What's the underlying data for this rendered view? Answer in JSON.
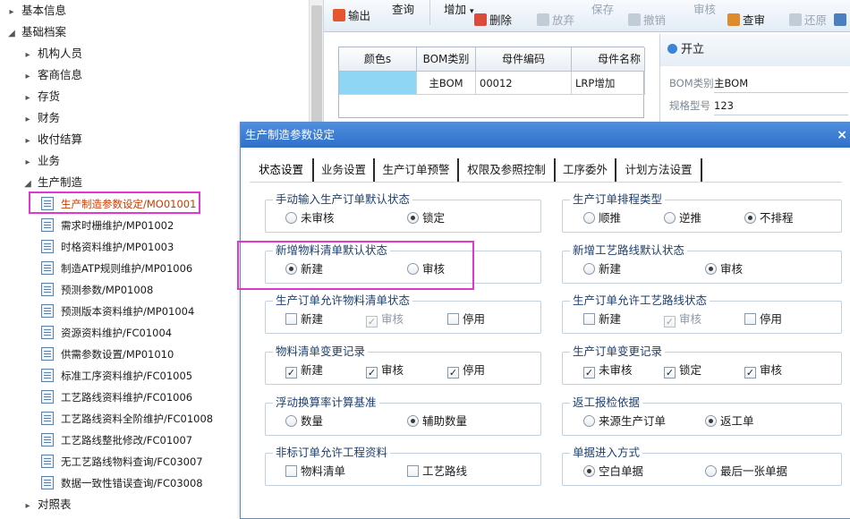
{
  "tree": {
    "items": [
      {
        "label": "基本信息",
        "arrow": "▸",
        "level": 0
      },
      {
        "label": "基础档案",
        "arrow": "◢",
        "level": 0
      },
      {
        "label": "机构人员",
        "arrow": "▸",
        "level": 1
      },
      {
        "label": "客商信息",
        "arrow": "▸",
        "level": 1
      },
      {
        "label": "存货",
        "arrow": "▸",
        "level": 1
      },
      {
        "label": "财务",
        "arrow": "▸",
        "level": 1
      },
      {
        "label": "收付结算",
        "arrow": "▸",
        "level": 1
      },
      {
        "label": "业务",
        "arrow": "▸",
        "level": 1
      },
      {
        "label": "生产制造",
        "arrow": "◢",
        "level": 1
      }
    ],
    "leaves": [
      {
        "label": "生产制造参数设定/MO01001"
      },
      {
        "label": "需求时栅维护/MP01002"
      },
      {
        "label": "时格资料维护/MP01003"
      },
      {
        "label": "制造ATP规则维护/MP01006"
      },
      {
        "label": "预测参数/MP01008"
      },
      {
        "label": "预测版本资料维护/MP01004"
      },
      {
        "label": "资源资料维护/FC01004"
      },
      {
        "label": "供需参数设置/MP01010"
      },
      {
        "label": "标准工序资料维护/FC01005"
      },
      {
        "label": "工艺路线资料维护/FC01006"
      },
      {
        "label": "工艺路线资料全阶维护/FC01008"
      },
      {
        "label": "工艺路线整批修改/FC01007"
      },
      {
        "label": "无工艺路线物料查询/FC03007"
      },
      {
        "label": "数据一致性错误查询/FC03008"
      }
    ],
    "last": {
      "label": "对照表",
      "arrow": "▸"
    }
  },
  "toolbar": {
    "output": "输出",
    "query": "查询",
    "add": "增加",
    "delete": "删除",
    "abandon": "放弃",
    "save": "保存",
    "revoke": "撤销",
    "audit": "审核",
    "check": "查审",
    "restore": "还原"
  },
  "grid": {
    "columns": [
      "颜色s",
      "BOM类别",
      "母件编码",
      "母件名称"
    ],
    "row": [
      "",
      "主BOM",
      "00012",
      "LRP增加"
    ]
  },
  "props": {
    "header": "开立",
    "bom_label": "BOM类别",
    "bom_value": "主BOM",
    "spec_label": "规格型号",
    "spec_value": "123"
  },
  "dialog": {
    "title": "生产制造参数设定",
    "close": "×",
    "tabs": [
      "状态设置",
      "业务设置",
      "生产订单预警",
      "权限及参照控制",
      "工序委外",
      "计划方法设置"
    ],
    "groups": {
      "g1": {
        "title": "手动输入生产订单默认状态",
        "opts": [
          "未审核",
          "锁定"
        ]
      },
      "g2": {
        "title": "新增物料清单默认状态",
        "opts": [
          "新建",
          "审核"
        ]
      },
      "g3": {
        "title": "生产订单允许物料清单状态",
        "opts": [
          "新建",
          "审核",
          "停用"
        ]
      },
      "g4": {
        "title": "物料清单变更记录",
        "opts": [
          "新建",
          "审核",
          "停用"
        ]
      },
      "g5": {
        "title": "浮动换算率计算基准",
        "opts": [
          "数量",
          "辅助数量"
        ]
      },
      "g6": {
        "title": "非标订单允许工程资料",
        "opts": [
          "物料清单",
          "工艺路线"
        ]
      },
      "g7": {
        "title": "生产订单排程类型",
        "opts": [
          "顺推",
          "逆推",
          "不排程"
        ]
      },
      "g8": {
        "title": "新增工艺路线默认状态",
        "opts": [
          "新建",
          "审核"
        ]
      },
      "g9": {
        "title": "生产订单允许工艺路线状态",
        "opts": [
          "新建",
          "审核",
          "停用"
        ]
      },
      "g10": {
        "title": "生产订单变更记录",
        "opts": [
          "未审核",
          "锁定",
          "审核"
        ]
      },
      "g11": {
        "title": "返工报检依据",
        "opts": [
          "来源生产订单",
          "返工单"
        ]
      },
      "g12": {
        "title": "单据进入方式",
        "opts": [
          "空白单据",
          "最后一张单据"
        ]
      }
    },
    "checkmark": "✓"
  },
  "colors": {
    "accent": "#3377cc",
    "highlight": "#e037d0",
    "selected_text": "#c83b00"
  }
}
